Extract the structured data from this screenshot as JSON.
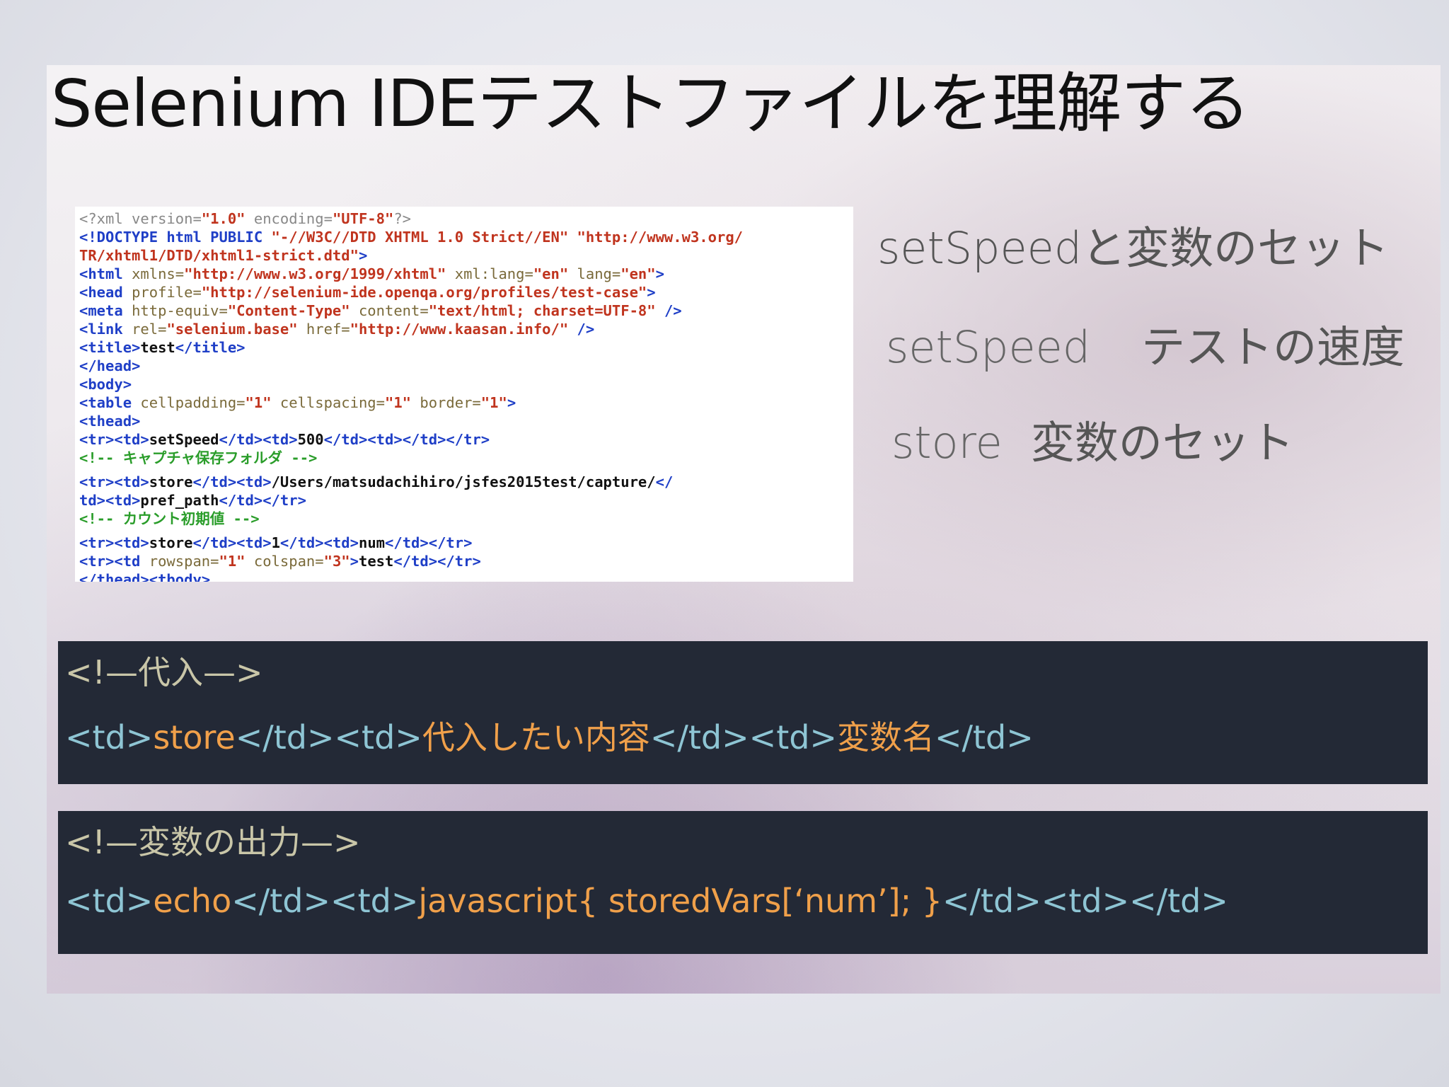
{
  "slide": {
    "title": "Selenium IDEテストファイルを理解する"
  },
  "code_lines": [
    [
      {
        "c": "pi",
        "t": "<?xml version="
      },
      {
        "c": "val",
        "t": "\"1.0\""
      },
      {
        "c": "pi",
        "t": " encoding="
      },
      {
        "c": "val",
        "t": "\"UTF-8\""
      },
      {
        "c": "pi",
        "t": "?>"
      }
    ],
    [
      {
        "c": "tag",
        "t": "<!DOCTYPE html PUBLIC "
      },
      {
        "c": "val",
        "t": "\"-//W3C//DTD XHTML 1.0 Strict//EN\" \"http://www.w3.org/"
      }
    ],
    [
      {
        "c": "val",
        "t": "TR/xhtml1/DTD/xhtml1-strict.dtd\""
      },
      {
        "c": "tag",
        "t": ">"
      }
    ],
    [
      {
        "c": "tag",
        "t": "<html "
      },
      {
        "c": "attr",
        "t": "xmlns="
      },
      {
        "c": "val",
        "t": "\"http://www.w3.org/1999/xhtml\""
      },
      {
        "c": "attr",
        "t": " xml:lang="
      },
      {
        "c": "val",
        "t": "\"en\""
      },
      {
        "c": "attr",
        "t": " lang="
      },
      {
        "c": "val",
        "t": "\"en\""
      },
      {
        "c": "tag",
        "t": ">"
      }
    ],
    [
      {
        "c": "tag",
        "t": "<head "
      },
      {
        "c": "attr",
        "t": "profile="
      },
      {
        "c": "val",
        "t": "\"http://selenium-ide.openqa.org/profiles/test-case\""
      },
      {
        "c": "tag",
        "t": ">"
      }
    ],
    [
      {
        "c": "tag",
        "t": "<meta "
      },
      {
        "c": "attr",
        "t": "http-equiv="
      },
      {
        "c": "val",
        "t": "\"Content-Type\""
      },
      {
        "c": "attr",
        "t": " content="
      },
      {
        "c": "val",
        "t": "\"text/html; charset=UTF-8\""
      },
      {
        "c": "tag",
        "t": " />"
      }
    ],
    [
      {
        "c": "tag",
        "t": "<link "
      },
      {
        "c": "attr",
        "t": "rel="
      },
      {
        "c": "val",
        "t": "\"selenium.base\""
      },
      {
        "c": "attr",
        "t": " href="
      },
      {
        "c": "val",
        "t": "\"http://www.kaasan.info/\""
      },
      {
        "c": "tag",
        "t": " />"
      }
    ],
    [
      {
        "c": "tag",
        "t": "<title>"
      },
      {
        "c": "txt",
        "t": "test"
      },
      {
        "c": "tag",
        "t": "</title>"
      }
    ],
    [
      {
        "c": "tag",
        "t": "</head>"
      }
    ],
    [
      {
        "c": "tag",
        "t": "<body>"
      }
    ],
    [
      {
        "c": "tag",
        "t": "<table "
      },
      {
        "c": "attr",
        "t": "cellpadding="
      },
      {
        "c": "val",
        "t": "\"1\""
      },
      {
        "c": "attr",
        "t": " cellspacing="
      },
      {
        "c": "val",
        "t": "\"1\""
      },
      {
        "c": "attr",
        "t": " border="
      },
      {
        "c": "val",
        "t": "\"1\""
      },
      {
        "c": "tag",
        "t": ">"
      }
    ],
    [
      {
        "c": "tag",
        "t": "<thead>"
      }
    ],
    [
      {
        "c": "tag",
        "t": "<tr><td>"
      },
      {
        "c": "txt",
        "t": "setSpeed"
      },
      {
        "c": "tag",
        "t": "</td><td>"
      },
      {
        "c": "txt",
        "t": "500"
      },
      {
        "c": "tag",
        "t": "</td><td></td></tr>"
      }
    ],
    [
      {
        "c": "cmt",
        "t": "<!-- キャプチャ保存フォルダ -->"
      }
    ],
    [
      {
        "c": "tag",
        "t": "<tr><td>"
      },
      {
        "c": "txt",
        "t": "store"
      },
      {
        "c": "tag",
        "t": "</td><td>"
      },
      {
        "c": "txt",
        "t": "/Users/matsudachihiro/jsfes2015test/capture/"
      },
      {
        "c": "tag",
        "t": "</"
      }
    ],
    [
      {
        "c": "tag",
        "t": "td><td>"
      },
      {
        "c": "txt",
        "t": "pref_path"
      },
      {
        "c": "tag",
        "t": "</td></tr>"
      }
    ],
    [
      {
        "c": "cmt",
        "t": "<!-- カウント初期値 -->"
      }
    ],
    [
      {
        "c": "tag",
        "t": "<tr><td>"
      },
      {
        "c": "txt",
        "t": "store"
      },
      {
        "c": "tag",
        "t": "</td><td>"
      },
      {
        "c": "txt",
        "t": "1"
      },
      {
        "c": "tag",
        "t": "</td><td>"
      },
      {
        "c": "txt",
        "t": "num"
      },
      {
        "c": "tag",
        "t": "</td></tr>"
      }
    ],
    [
      {
        "c": "tag",
        "t": "<tr><td "
      },
      {
        "c": "attr",
        "t": "rowspan="
      },
      {
        "c": "val",
        "t": "\"1\""
      },
      {
        "c": "attr",
        "t": " colspan="
      },
      {
        "c": "val",
        "t": "\"3\""
      },
      {
        "c": "tag",
        "t": ">"
      },
      {
        "c": "txt",
        "t": "test"
      },
      {
        "c": "tag",
        "t": "</td></tr>"
      }
    ],
    [
      {
        "c": "tag",
        "t": "</thead><tbody>"
      }
    ]
  ],
  "gap_before_lines": [
    14,
    17
  ],
  "side": {
    "line1": "setSpeedと変数のセット",
    "line2_key": "setSpeed",
    "line2_desc": "テストの速度",
    "line3_key": "store",
    "line3_desc": "変数のセット"
  },
  "box1": {
    "comment": "<!—代入—>",
    "code": [
      {
        "c": "tag",
        "t": "<td>"
      },
      {
        "c": "val",
        "t": "store"
      },
      {
        "c": "tag",
        "t": "</td><td>"
      },
      {
        "c": "val",
        "t": "代入したい内容"
      },
      {
        "c": "tag",
        "t": "</td><td>"
      },
      {
        "c": "val",
        "t": "変数名"
      },
      {
        "c": "tag",
        "t": "</td>"
      }
    ]
  },
  "box2": {
    "comment": "<!—変数の出力—>",
    "code": [
      {
        "c": "tag",
        "t": "<td>"
      },
      {
        "c": "val",
        "t": "echo"
      },
      {
        "c": "tag",
        "t": "</td><td>"
      },
      {
        "c": "val",
        "t": "javascript{ storedVars[‘num’]; }"
      },
      {
        "c": "tag",
        "t": "</td><td></td>"
      }
    ]
  }
}
